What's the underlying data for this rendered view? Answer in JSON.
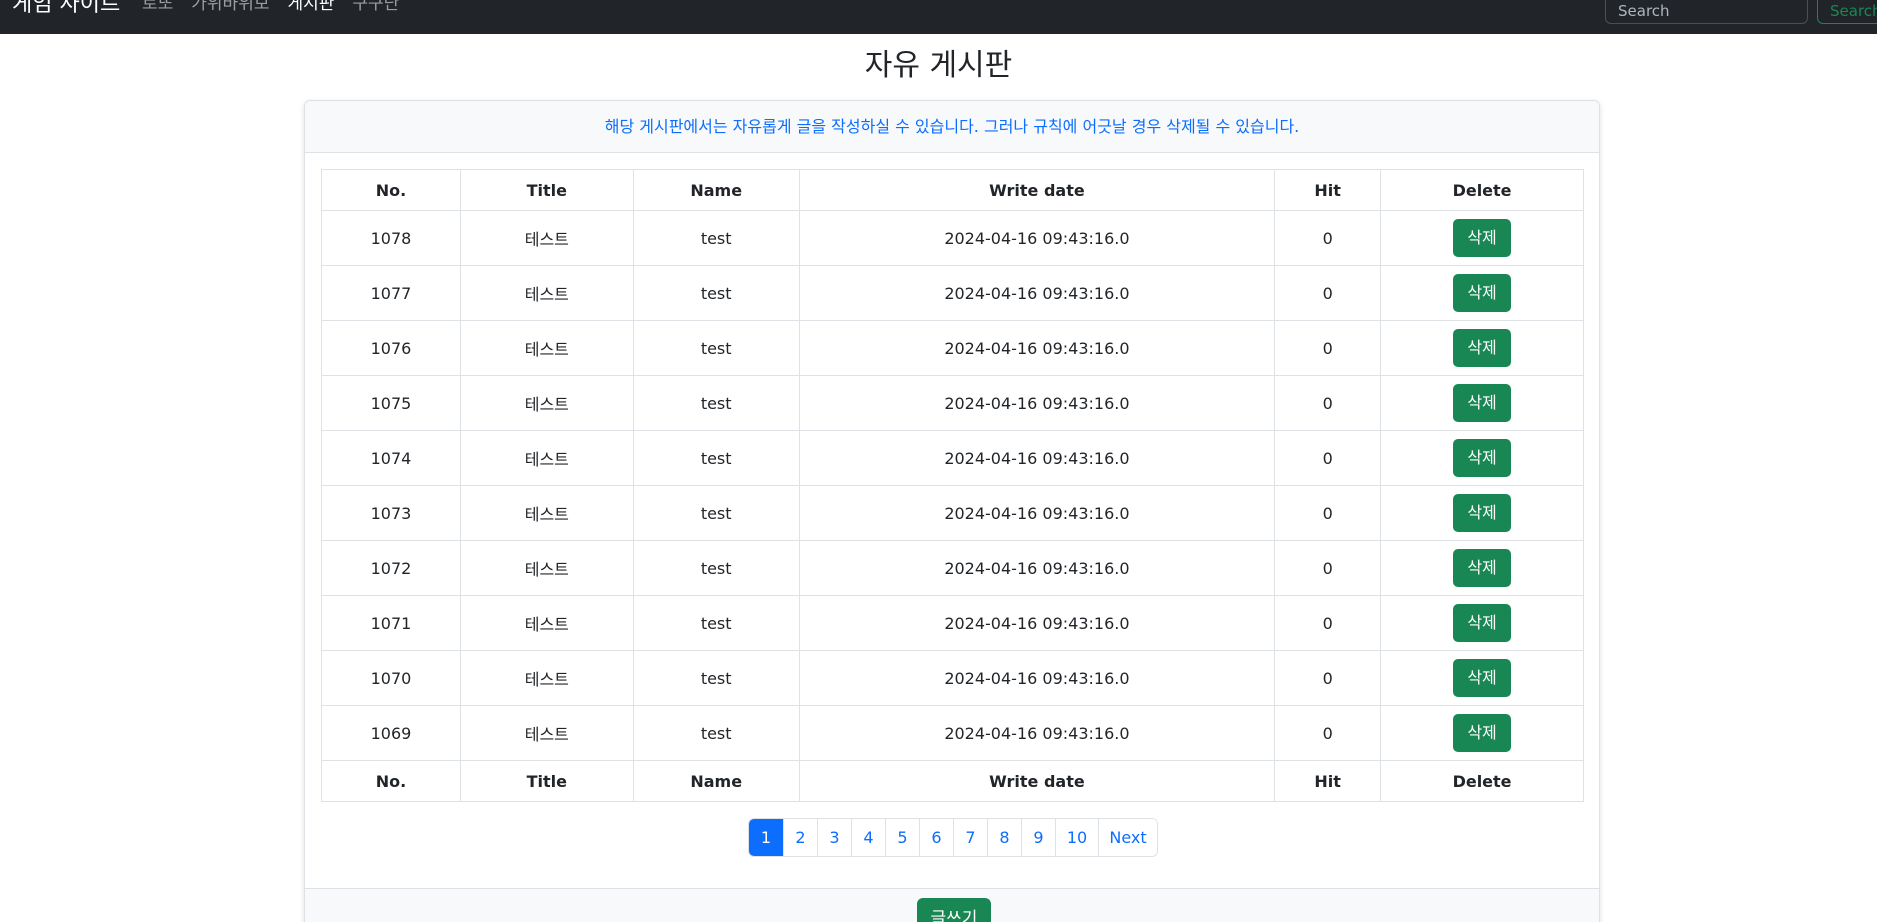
{
  "navbar": {
    "brand": "게임 사이트",
    "links": [
      {
        "label": "로또",
        "active": false
      },
      {
        "label": "가위바위보",
        "active": false
      },
      {
        "label": "게시판",
        "active": true
      },
      {
        "label": "구구단",
        "active": false
      }
    ],
    "search_placeholder": "Search",
    "search_button": "Search"
  },
  "page": {
    "title": "자유 게시판",
    "notice": "해당 게시판에서는 자유롭게 글을 작성하실 수 있습니다. 그러나 규칙에 어긋날 경우 삭제될 수 있습니다."
  },
  "table": {
    "columns": [
      "No.",
      "Title",
      "Name",
      "Write date",
      "Hit",
      "Delete"
    ],
    "delete_label": "삭제",
    "rows": [
      {
        "no": "1078",
        "title": "테스트",
        "name": "test",
        "date": "2024-04-16 09:43:16.0",
        "hit": "0"
      },
      {
        "no": "1077",
        "title": "테스트",
        "name": "test",
        "date": "2024-04-16 09:43:16.0",
        "hit": "0"
      },
      {
        "no": "1076",
        "title": "테스트",
        "name": "test",
        "date": "2024-04-16 09:43:16.0",
        "hit": "0"
      },
      {
        "no": "1075",
        "title": "테스트",
        "name": "test",
        "date": "2024-04-16 09:43:16.0",
        "hit": "0"
      },
      {
        "no": "1074",
        "title": "테스트",
        "name": "test",
        "date": "2024-04-16 09:43:16.0",
        "hit": "0"
      },
      {
        "no": "1073",
        "title": "테스트",
        "name": "test",
        "date": "2024-04-16 09:43:16.0",
        "hit": "0"
      },
      {
        "no": "1072",
        "title": "테스트",
        "name": "test",
        "date": "2024-04-16 09:43:16.0",
        "hit": "0"
      },
      {
        "no": "1071",
        "title": "테스트",
        "name": "test",
        "date": "2024-04-16 09:43:16.0",
        "hit": "0"
      },
      {
        "no": "1070",
        "title": "테스트",
        "name": "test",
        "date": "2024-04-16 09:43:16.0",
        "hit": "0"
      },
      {
        "no": "1069",
        "title": "테스트",
        "name": "test",
        "date": "2024-04-16 09:43:16.0",
        "hit": "0"
      }
    ]
  },
  "pagination": {
    "pages": [
      "1",
      "2",
      "3",
      "4",
      "5",
      "6",
      "7",
      "8",
      "9",
      "10"
    ],
    "active": "1",
    "next_label": "Next"
  },
  "footer": {
    "write_label": "글쓰기"
  },
  "colors": {
    "navbar_bg": "#212529",
    "primary": "#0d6efd",
    "success": "#198754"
  }
}
